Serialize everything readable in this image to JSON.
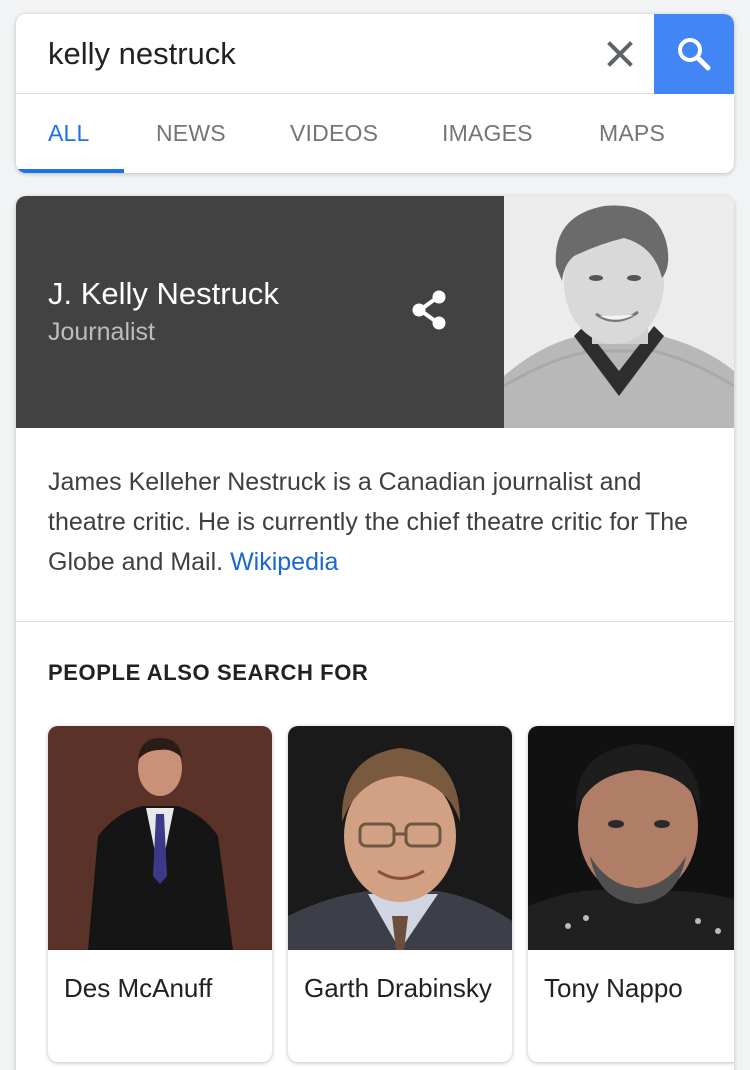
{
  "search": {
    "query": "kelly nestruck",
    "clear_icon": "close-icon",
    "search_icon": "search-icon"
  },
  "tabs": [
    {
      "label": "ALL",
      "active": true
    },
    {
      "label": "NEWS",
      "active": false
    },
    {
      "label": "VIDEOS",
      "active": false
    },
    {
      "label": "IMAGES",
      "active": false
    },
    {
      "label": "MAPS",
      "active": false
    }
  ],
  "knowledge_panel": {
    "title": "J. Kelly Nestruck",
    "subtitle": "Journalist",
    "share_icon": "share-icon",
    "description": "James Kelleher Nestruck is a Canadian journalist and theatre critic. He is currently the chief theatre critic for The Globe and Mail.",
    "source_link": "Wikipedia"
  },
  "people_also_search": {
    "heading": "PEOPLE ALSO SEARCH FOR",
    "people": [
      {
        "name": "Des McAnuff"
      },
      {
        "name": "Garth Drabinsky"
      },
      {
        "name": "Tony Nappo"
      }
    ]
  },
  "colors": {
    "accent": "#4285f4",
    "active_tab": "#1a73e8",
    "header_bg": "#424242",
    "link": "#1967d2"
  }
}
